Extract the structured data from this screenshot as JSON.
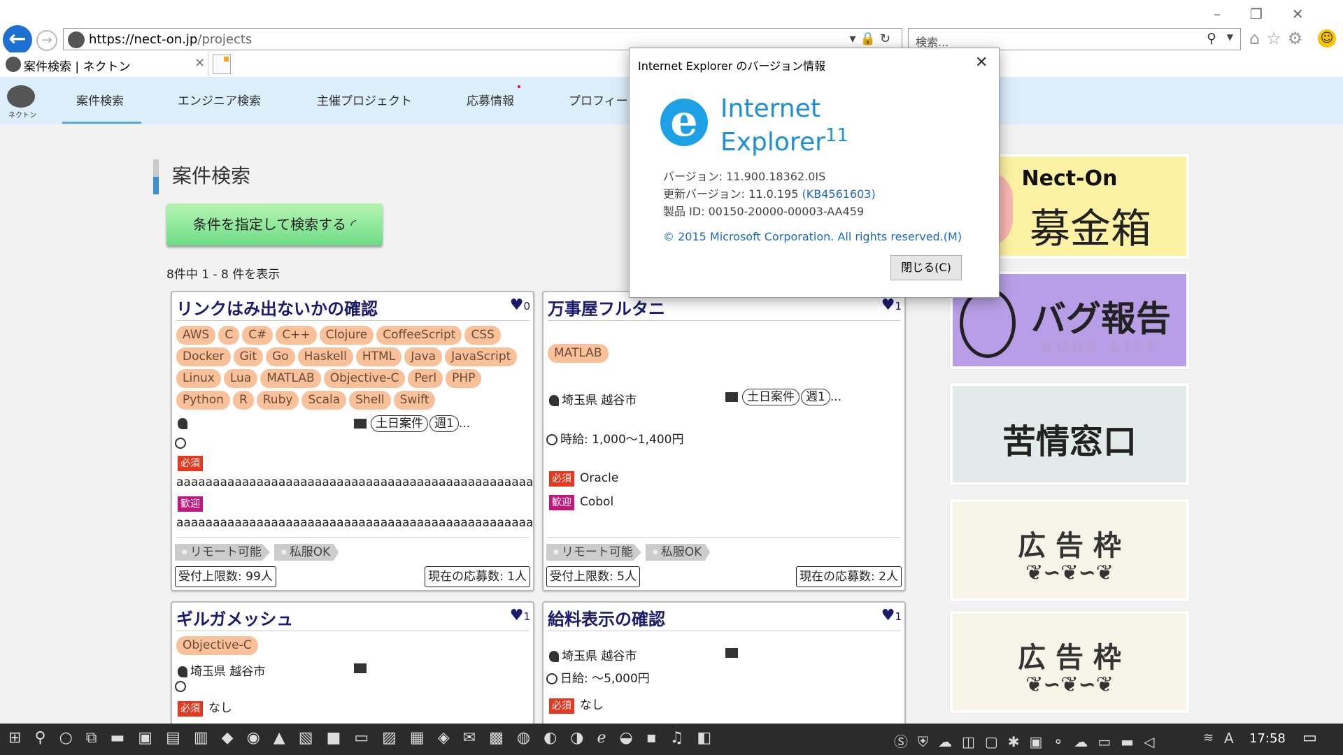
{
  "browser": {
    "url_host": "https://nect-on.jp",
    "url_path": "/projects",
    "search_placeholder": "検索...",
    "tab_title": "案件検索 | ネクトン",
    "tab_close": "×"
  },
  "site": {
    "logo_text": "ネクトン",
    "nav": [
      "案件検索",
      "エンジニア検索",
      "主催プロジェクト",
      "応募情報",
      "プロフィー"
    ],
    "page_title": "案件検索",
    "search_button": "条件を指定して検索する",
    "result_count": "8件中 1 - 8 件を表示"
  },
  "cards": [
    {
      "title": "リンクはみ出ないかの確認",
      "likes": "0",
      "tags": [
        "AWS",
        "C",
        "C#",
        "C++",
        "Clojure",
        "CoffeeScript",
        "CSS",
        "Docker",
        "Git",
        "Go",
        "Haskell",
        "HTML",
        "Java",
        "JavaScript",
        "Linux",
        "Lua",
        "MATLAB",
        "Objective-C",
        "Perl",
        "PHP",
        "Python",
        "R",
        "Ruby",
        "Scala",
        "Shell",
        "Swift"
      ],
      "location": "",
      "schedule_tag": "土日案件",
      "freq_tag": "週1",
      "ellipsis": "...",
      "pay": "",
      "required_label": "必須",
      "required": "aaaaaaaaaaaaaaaaaaaaaaaaaaaaaaaaaaaaaaaaaaaaaaaaaaaaaaaaaaaaa",
      "welcome_label": "歓迎",
      "welcome": "aaaaaaaaaaaaaaaaaaaaaaaaaaaaaaaaaaaaaaaaaaaaaaaaaaaaaaaaaaaaa",
      "perks": [
        "リモート可能",
        "私服OK"
      ],
      "capacity": "受付上限数: 99人",
      "applicants": "現在の応募数: 1人"
    },
    {
      "title": "万事屋フルタニ",
      "likes": "1",
      "tags": [
        "MATLAB"
      ],
      "location": "埼玉県 越谷市",
      "schedule_tag": "土日案件",
      "freq_tag": "週1",
      "ellipsis": "...",
      "pay": "時給: 1,000〜1,400円",
      "required_label": "必須",
      "required": "Oracle",
      "welcome_label": "歓迎",
      "welcome": "Cobol",
      "perks": [
        "リモート可能",
        "私服OK"
      ],
      "capacity": "受付上限数: 5人",
      "applicants": "現在の応募数: 2人"
    },
    {
      "title": "ギルガメッシュ",
      "likes": "1",
      "tags": [
        "Objective-C"
      ],
      "location": "埼玉県 越谷市",
      "required_label": "必須",
      "required": "なし"
    },
    {
      "title": "給料表示の確認",
      "likes": "1",
      "location": "埼玉県 越谷市",
      "pay": "日給: 〜5,000円",
      "required_label": "必須",
      "required": "なし"
    }
  ],
  "ads": {
    "ad1_line1": "Nect-On",
    "ad1_line2": "募金箱",
    "ad2_line1": "バグ報告",
    "ad2_line2": "BUGS LIFE",
    "ad3": "苦情窓口",
    "ad4": "広 告 枠",
    "ad5": "広 告 枠"
  },
  "dialog": {
    "title": "Internet Explorer のバージョン情報",
    "logo_line1": "Internet",
    "logo_line2": "Explorer",
    "logo_version": "11",
    "version": "バージョン: 11.900.18362.0IS",
    "update_prefix": "更新バージョン: 11.0.195 ",
    "update_link": "(KB4561603)",
    "product_id": "製品 ID: 00150-20000-00003-AA459",
    "copyright": "© 2015 Microsoft Corporation. All rights reserved.(M)",
    "close_button": "閉じる(C)"
  },
  "taskbar": {
    "clock": "17:58"
  },
  "colors": {
    "accent": "#1e6fd2",
    "nav_bg": "#ddeefb",
    "tag_bg": "#f9c199",
    "required": "#e5381e",
    "welcome": "#c2187e",
    "ie_blue": "#1e8fd9"
  }
}
